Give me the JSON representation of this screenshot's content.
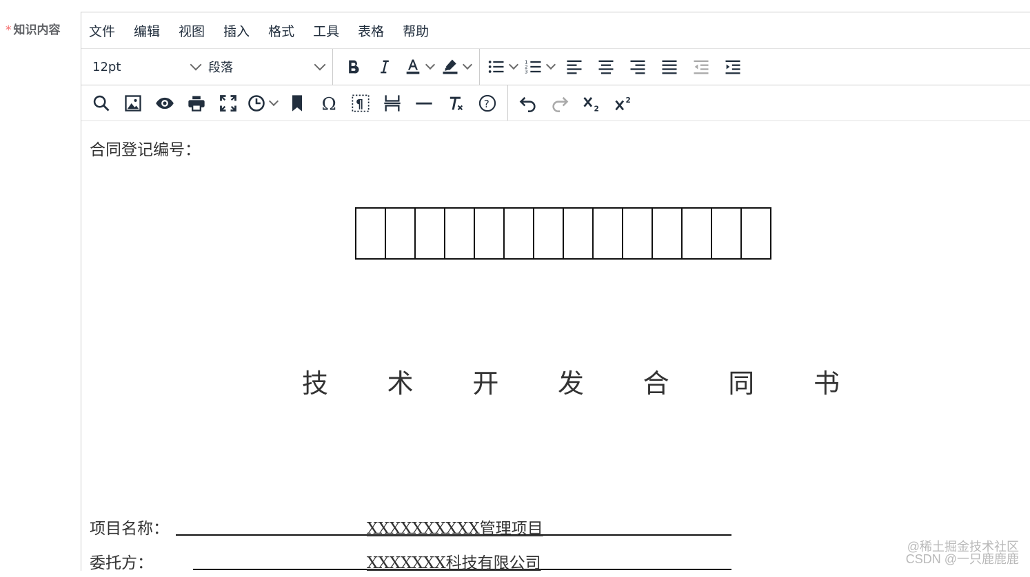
{
  "form": {
    "required_mark": "*",
    "label": "知识内容"
  },
  "menubar": [
    "文件",
    "编辑",
    "视图",
    "插入",
    "格式",
    "工具",
    "表格",
    "帮助"
  ],
  "toolbar": {
    "font_size": "12pt",
    "block_format": "段落"
  },
  "document": {
    "registration_label": "合同登记编号：",
    "registration_boxes": 14,
    "title_chars": [
      "技",
      "术",
      "开",
      "发",
      "合",
      "同",
      "书"
    ],
    "fields": [
      {
        "label": "项目名称：",
        "value": "XXXXXXXXXX管理项目"
      },
      {
        "label": "委托方：",
        "value": "XXXXXXX科技有限公司"
      }
    ]
  },
  "watermark": {
    "line1": "@稀土掘金技术社区",
    "line2": "CSDN @一只鹿鹿鹿"
  }
}
